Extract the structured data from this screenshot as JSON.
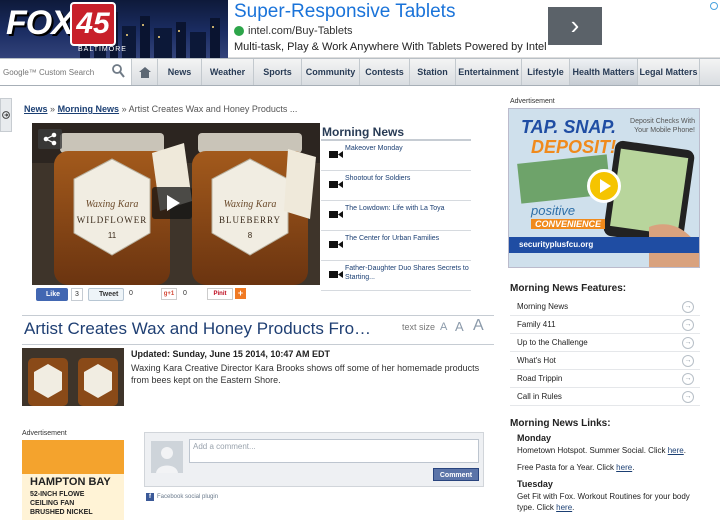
{
  "brand": {
    "logo_text": "FOX",
    "logo_number": "45",
    "logo_sub": "BALTIMORE"
  },
  "top_ad": {
    "title": "Super-Responsive Tablets",
    "url": "intel.com/Buy-Tablets",
    "description": "Multi-task, Play & Work Anywhere With Tablets Powered by Intel",
    "arrow": "›"
  },
  "nav": {
    "search_placeholder": "Google™ Custom Search",
    "items": [
      "News",
      "Weather",
      "Sports",
      "Community",
      "Contests",
      "Station",
      "Entertainment",
      "Lifestyle",
      "Health Matters",
      "Legal Matters"
    ]
  },
  "breadcrumb": {
    "crumb1": "News",
    "sep": "»",
    "crumb2": "Morning News",
    "current": "Artist Creates Wax and Honey Products ..."
  },
  "video": {
    "jar_left": "WILDFLOWER",
    "jar_right": "BLUEBERRY",
    "jar_brand": "Waxing Kara",
    "num_left": "11",
    "num_right": "8"
  },
  "morning_news": {
    "title": "Morning News",
    "items": [
      "Makeover Monday",
      "Shootout for Soldiers",
      "The Lowdown: Life with La Toya",
      "The Center for Urban Families",
      "Father-Daughter Duo Shares Secrets to Starting..."
    ]
  },
  "social": {
    "like_label": "Like",
    "like_count": "3",
    "tweet_label": "Tweet",
    "tweet_count": "0",
    "gplus_label": "g+1",
    "gplus_count": "0",
    "pin_label": "Pinit",
    "plus_label": "+"
  },
  "headline": {
    "title": "Artist Creates Wax and Honey Products Fro…",
    "text_size_label": "text size",
    "sizes": [
      "A",
      "A",
      "A"
    ]
  },
  "article": {
    "updated": "Updated: Sunday, June 15 2014, 10:47 AM EDT",
    "body": "Waxing Kara Creative Director Kara Brooks shows off some of her homemade products from bees kept on the Eastern Shore."
  },
  "ad_left": {
    "label": "Advertisement",
    "brand": "HAMPTON BAY",
    "line1": "52-INCH FLOWE",
    "line2": "CEILING FAN",
    "line3": "BRUSHED NICKEL"
  },
  "comments": {
    "placeholder": "Add a comment...",
    "button": "Comment",
    "plugin": "Facebook social plugin"
  },
  "right_ad": {
    "label": "Advertisement",
    "headline1": "TAP. SNAP.",
    "headline2": "DEPOSIT!",
    "side_text": "Deposit Checks With Your Mobile Phone!",
    "positive": "positive",
    "convenience": "CONVENIENCE",
    "url": "securityplusfcu.org"
  },
  "features": {
    "title": "Morning News Features:",
    "items": [
      "Morning News",
      "Family 411",
      "Up to the Challenge",
      "What's Hot",
      "Road Trippin",
      "Call in Rules"
    ]
  },
  "links": {
    "title": "Morning News Links:",
    "entries": [
      {
        "day": "Monday",
        "text": "Hometown Hotspot. Summer Social. Click",
        "link": "here"
      },
      {
        "day": "",
        "text": "Free Pasta for a Year. Click",
        "link": "here"
      },
      {
        "day": "Tuesday",
        "text": "Get Fit with Fox. Workout Routines for your body type. Click",
        "link": "here"
      }
    ]
  },
  "colors": {
    "brand_navy": "#283b55",
    "link_blue": "#1b3f73",
    "accent_blue": "#1a73d9",
    "fb_blue": "#4267b2"
  }
}
